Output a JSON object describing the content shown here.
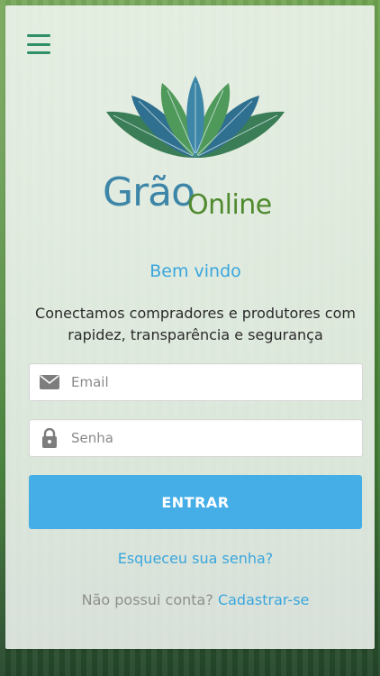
{
  "app": {
    "brand_primary": "Grão",
    "brand_secondary": "Online",
    "colors": {
      "accent": "#45aee7",
      "link": "#3aa6dd",
      "brand_blue": "#3d86a8",
      "brand_green": "#4f8a2e",
      "menu_green": "#2f8f68"
    }
  },
  "header": {
    "menu_icon": "hamburger-menu-icon"
  },
  "login": {
    "welcome_title": "Bem vindo",
    "tagline": "Conectamos compradores e produtores com rapidez, transparência e segurança",
    "email": {
      "placeholder": "Email",
      "value": "",
      "icon": "envelope-icon"
    },
    "password": {
      "placeholder": "Senha",
      "value": "",
      "icon": "lock-icon"
    },
    "submit_label": "ENTRAR",
    "forgot_password_label": "Esqueceu sua senha?",
    "signup_prompt": "Não possui conta?",
    "signup_link_label": "Cadastrar-se"
  }
}
